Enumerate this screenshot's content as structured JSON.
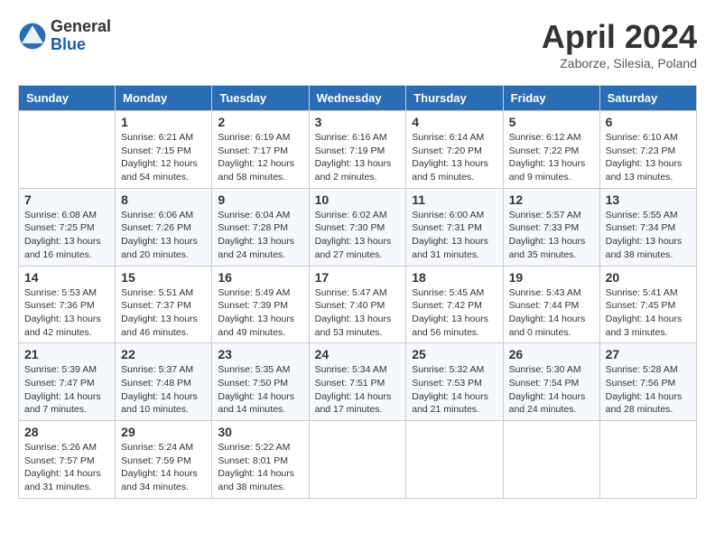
{
  "logo": {
    "general": "General",
    "blue": "Blue"
  },
  "title": "April 2024",
  "location": "Zaborze, Silesia, Poland",
  "weekdays": [
    "Sunday",
    "Monday",
    "Tuesday",
    "Wednesday",
    "Thursday",
    "Friday",
    "Saturday"
  ],
  "weeks": [
    [
      {
        "day": "",
        "info": ""
      },
      {
        "day": "1",
        "info": "Sunrise: 6:21 AM\nSunset: 7:15 PM\nDaylight: 12 hours\nand 54 minutes."
      },
      {
        "day": "2",
        "info": "Sunrise: 6:19 AM\nSunset: 7:17 PM\nDaylight: 12 hours\nand 58 minutes."
      },
      {
        "day": "3",
        "info": "Sunrise: 6:16 AM\nSunset: 7:19 PM\nDaylight: 13 hours\nand 2 minutes."
      },
      {
        "day": "4",
        "info": "Sunrise: 6:14 AM\nSunset: 7:20 PM\nDaylight: 13 hours\nand 5 minutes."
      },
      {
        "day": "5",
        "info": "Sunrise: 6:12 AM\nSunset: 7:22 PM\nDaylight: 13 hours\nand 9 minutes."
      },
      {
        "day": "6",
        "info": "Sunrise: 6:10 AM\nSunset: 7:23 PM\nDaylight: 13 hours\nand 13 minutes."
      }
    ],
    [
      {
        "day": "7",
        "info": "Sunrise: 6:08 AM\nSunset: 7:25 PM\nDaylight: 13 hours\nand 16 minutes."
      },
      {
        "day": "8",
        "info": "Sunrise: 6:06 AM\nSunset: 7:26 PM\nDaylight: 13 hours\nand 20 minutes."
      },
      {
        "day": "9",
        "info": "Sunrise: 6:04 AM\nSunset: 7:28 PM\nDaylight: 13 hours\nand 24 minutes."
      },
      {
        "day": "10",
        "info": "Sunrise: 6:02 AM\nSunset: 7:30 PM\nDaylight: 13 hours\nand 27 minutes."
      },
      {
        "day": "11",
        "info": "Sunrise: 6:00 AM\nSunset: 7:31 PM\nDaylight: 13 hours\nand 31 minutes."
      },
      {
        "day": "12",
        "info": "Sunrise: 5:57 AM\nSunset: 7:33 PM\nDaylight: 13 hours\nand 35 minutes."
      },
      {
        "day": "13",
        "info": "Sunrise: 5:55 AM\nSunset: 7:34 PM\nDaylight: 13 hours\nand 38 minutes."
      }
    ],
    [
      {
        "day": "14",
        "info": "Sunrise: 5:53 AM\nSunset: 7:36 PM\nDaylight: 13 hours\nand 42 minutes."
      },
      {
        "day": "15",
        "info": "Sunrise: 5:51 AM\nSunset: 7:37 PM\nDaylight: 13 hours\nand 46 minutes."
      },
      {
        "day": "16",
        "info": "Sunrise: 5:49 AM\nSunset: 7:39 PM\nDaylight: 13 hours\nand 49 minutes."
      },
      {
        "day": "17",
        "info": "Sunrise: 5:47 AM\nSunset: 7:40 PM\nDaylight: 13 hours\nand 53 minutes."
      },
      {
        "day": "18",
        "info": "Sunrise: 5:45 AM\nSunset: 7:42 PM\nDaylight: 13 hours\nand 56 minutes."
      },
      {
        "day": "19",
        "info": "Sunrise: 5:43 AM\nSunset: 7:44 PM\nDaylight: 14 hours\nand 0 minutes."
      },
      {
        "day": "20",
        "info": "Sunrise: 5:41 AM\nSunset: 7:45 PM\nDaylight: 14 hours\nand 3 minutes."
      }
    ],
    [
      {
        "day": "21",
        "info": "Sunrise: 5:39 AM\nSunset: 7:47 PM\nDaylight: 14 hours\nand 7 minutes."
      },
      {
        "day": "22",
        "info": "Sunrise: 5:37 AM\nSunset: 7:48 PM\nDaylight: 14 hours\nand 10 minutes."
      },
      {
        "day": "23",
        "info": "Sunrise: 5:35 AM\nSunset: 7:50 PM\nDaylight: 14 hours\nand 14 minutes."
      },
      {
        "day": "24",
        "info": "Sunrise: 5:34 AM\nSunset: 7:51 PM\nDaylight: 14 hours\nand 17 minutes."
      },
      {
        "day": "25",
        "info": "Sunrise: 5:32 AM\nSunset: 7:53 PM\nDaylight: 14 hours\nand 21 minutes."
      },
      {
        "day": "26",
        "info": "Sunrise: 5:30 AM\nSunset: 7:54 PM\nDaylight: 14 hours\nand 24 minutes."
      },
      {
        "day": "27",
        "info": "Sunrise: 5:28 AM\nSunset: 7:56 PM\nDaylight: 14 hours\nand 28 minutes."
      }
    ],
    [
      {
        "day": "28",
        "info": "Sunrise: 5:26 AM\nSunset: 7:57 PM\nDaylight: 14 hours\nand 31 minutes."
      },
      {
        "day": "29",
        "info": "Sunrise: 5:24 AM\nSunset: 7:59 PM\nDaylight: 14 hours\nand 34 minutes."
      },
      {
        "day": "30",
        "info": "Sunrise: 5:22 AM\nSunset: 8:01 PM\nDaylight: 14 hours\nand 38 minutes."
      },
      {
        "day": "",
        "info": ""
      },
      {
        "day": "",
        "info": ""
      },
      {
        "day": "",
        "info": ""
      },
      {
        "day": "",
        "info": ""
      }
    ]
  ]
}
